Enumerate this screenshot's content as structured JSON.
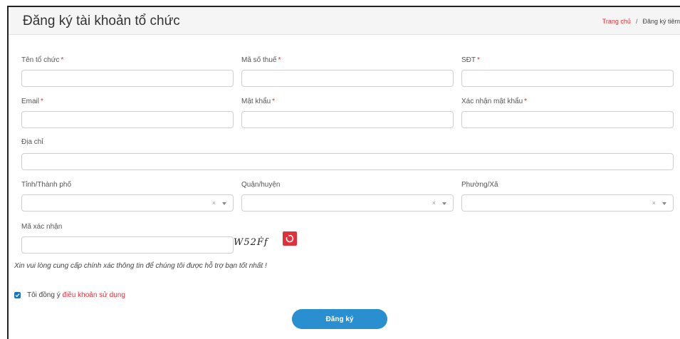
{
  "header": {
    "title": "Đăng ký tài khoản tổ chức",
    "breadcrumb_home": "Trang chủ",
    "breadcrumb_sep": "/",
    "breadcrumb_current": "Đăng ký tiêm"
  },
  "form": {
    "org_name_label": "Tên tổ chức",
    "tax_code_label": "Mã số thuế",
    "phone_label": "SĐT",
    "email_label": "Email",
    "password_label": "Mật khẩu",
    "confirm_password_label": "Xác nhận mật khẩu",
    "address_label": "Địa chỉ",
    "province_label": "Tỉnh/Thành phố",
    "district_label": "Quận/huyện",
    "ward_label": "Phường/Xã",
    "captcha_label": "Mã xác nhận",
    "required_mark": "*",
    "clear_glyph": "×",
    "captcha_text": "W52Ḟf",
    "note": "Xin vui lòng cung cấp chính xác thông tin để chúng tôi được hỗ trợ bạn tốt nhất !",
    "agree_prefix": "Tôi đồng ý ",
    "agree_link": "điều khoản sử dụng",
    "agree_checked": true,
    "submit_label": "Đăng ký"
  },
  "colors": {
    "accent_red": "#e0303a",
    "button_blue": "#2a8fd0",
    "checkbox_blue": "#1a73c9"
  }
}
